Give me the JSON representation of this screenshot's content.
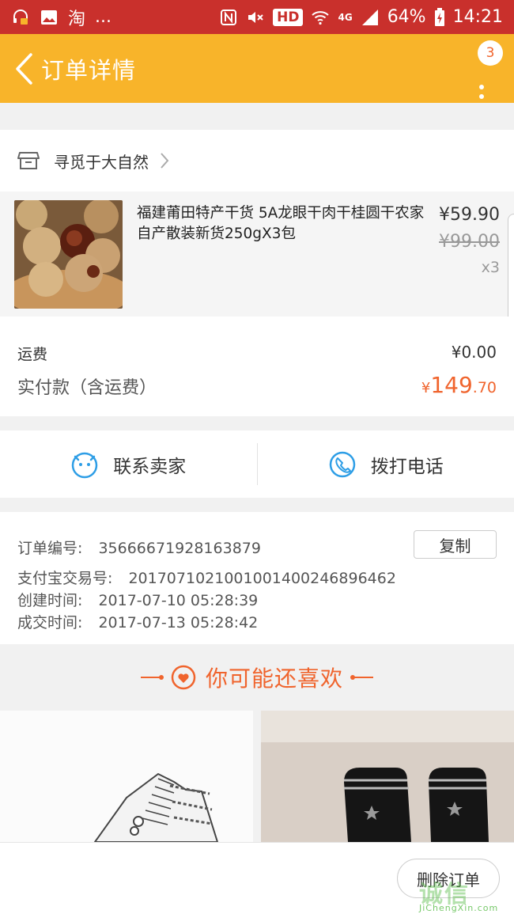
{
  "status_bar": {
    "app_name": "淘",
    "more": "...",
    "hd": "HD",
    "network": "4G",
    "battery": "64%",
    "time": "14:21"
  },
  "header": {
    "title": "订单详情",
    "badge_count": "3"
  },
  "shop": {
    "name": "寻觅于大自然"
  },
  "product": {
    "title": "福建莆田特产干货 5A龙眼干肉干桂圆干农家自产散装新货250gX3包",
    "price_now": "¥59.90",
    "price_old": "¥99.00",
    "quantity": "x3"
  },
  "totals": {
    "shipping_label": "运费",
    "shipping_value": "¥0.00",
    "paid_label": "实付款（含运费）",
    "paid_currency": "¥",
    "paid_int": "149",
    "paid_dec": ".70"
  },
  "contact": {
    "seller_label": "联系卖家",
    "phone_label": "拨打电话"
  },
  "order_info": {
    "order_no_label": "订单编号:",
    "order_no": "35666671928163879",
    "alipay_label": "支付宝交易号:",
    "alipay_no": "2017071021001001400246896462",
    "created_label": "创建时间:",
    "created": "2017-07-10 05:28:39",
    "closed_label": "成交时间:",
    "closed": "2017-07-13 05:28:42",
    "copy_label": "复制"
  },
  "recommend": {
    "title": "你可能还喜欢"
  },
  "bottom": {
    "delete_label": "删除订单"
  },
  "watermark": {
    "main": "诚信",
    "sub": "JiChengXin.com"
  },
  "colors": {
    "status_bar": "#c9302c",
    "header": "#f8b42a",
    "accent": "#f0642d",
    "contact_icon": "#2e9ee6"
  }
}
